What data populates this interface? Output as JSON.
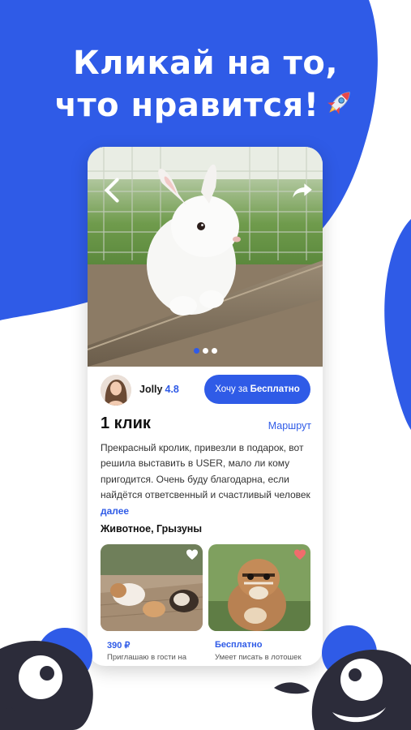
{
  "headline": {
    "line1": "Кликай на то,",
    "line2": "что нравится!"
  },
  "icons": {
    "rocket": "rocket-icon",
    "back": "chevron-left-icon",
    "share": "share-arrow-icon",
    "heart": "heart-icon"
  },
  "colors": {
    "brand_blue": "#2f5be7",
    "heart_active": "#f06c6c",
    "monster_dark": "#2c2c3a"
  },
  "listing": {
    "gallery": {
      "slides": 3,
      "active_slide": 1
    },
    "seller": {
      "name": "Jolly",
      "rating": "4.8"
    },
    "want_button": {
      "prefix": "Хочу за",
      "value": "Бесплатно"
    },
    "price": "1 клик",
    "route_link": "Маршрут",
    "description": "Прекрасный кролик, привезли в подарок, вот решила выставить в USER, мало ли кому пригодится. Очень буду благодарна, если найдётся ответсвенный и счастливый человек",
    "more_link": "далее",
    "category": "Животное, Грызуны"
  },
  "related": [
    {
      "price": "390 ₽",
      "description": "Приглашаю в гости на",
      "favorited": false
    },
    {
      "price": "Бесплатно",
      "description": "Умеет писать в лотошек",
      "favorited": true
    }
  ]
}
